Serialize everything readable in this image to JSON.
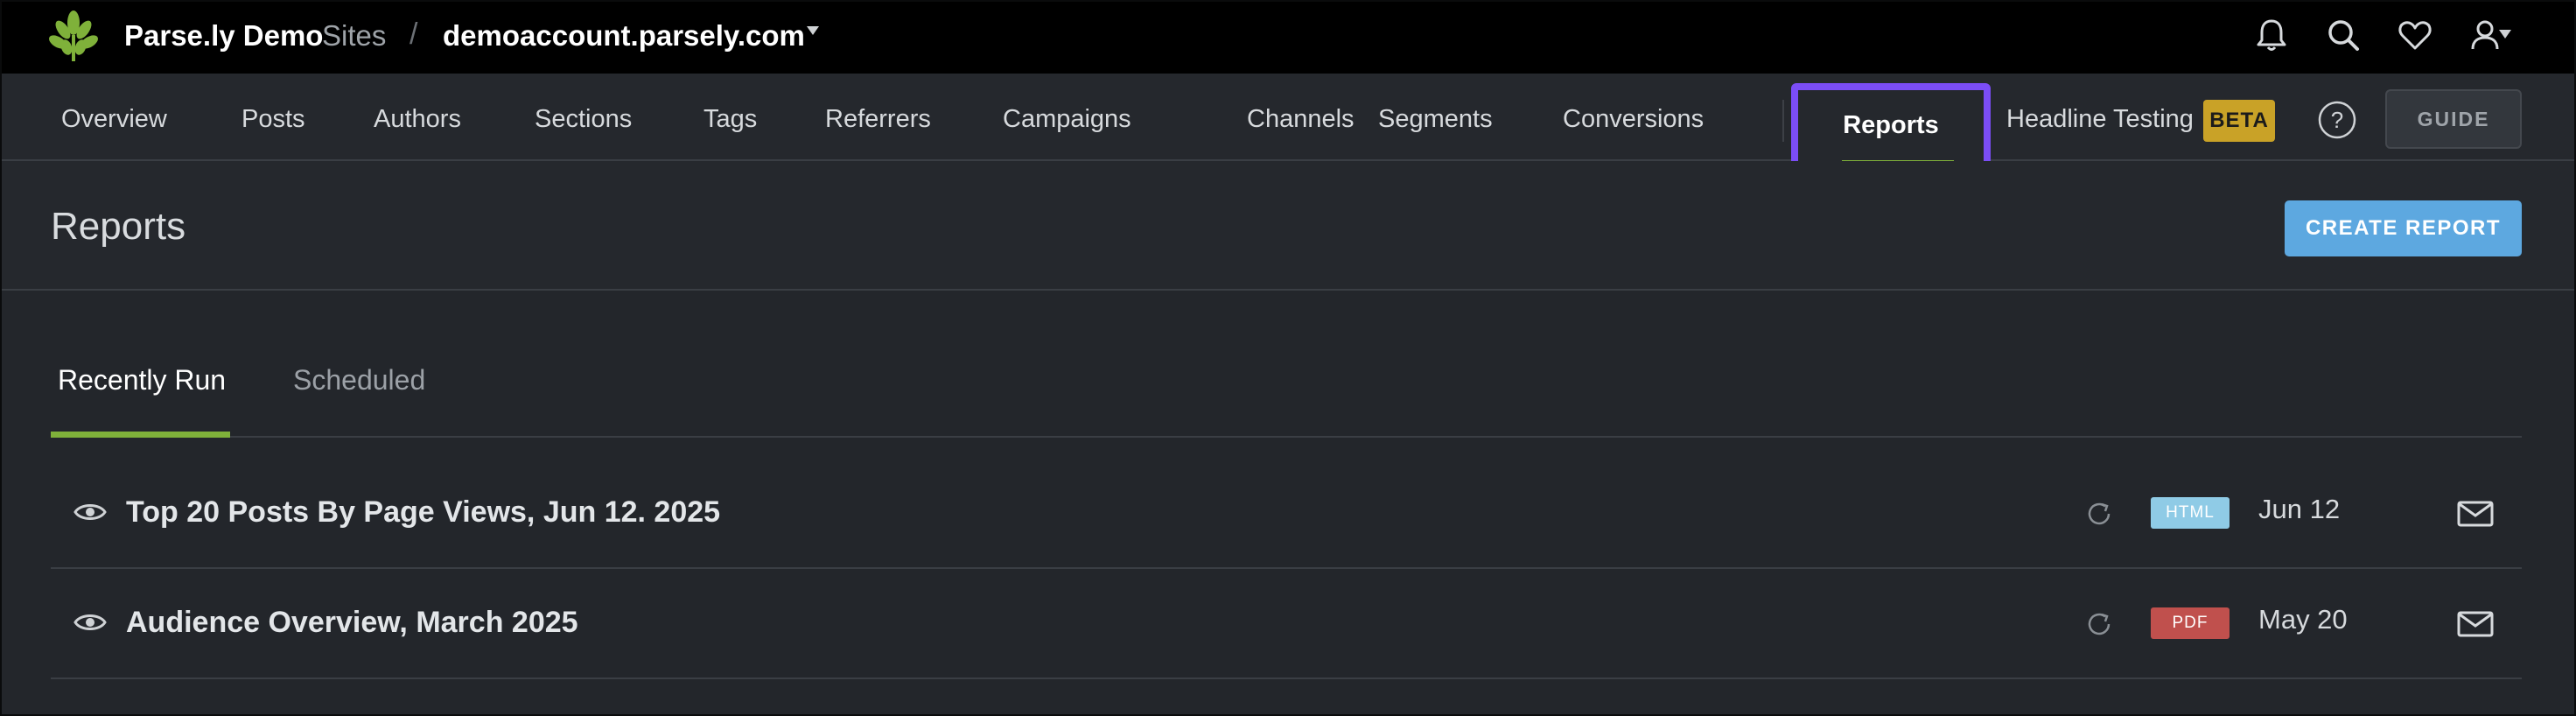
{
  "topbar": {
    "brand": "Parse.ly Demo",
    "sites_label": "Sites",
    "separator": "/",
    "account": "demoaccount.parsely.com",
    "icons": [
      "bell-icon",
      "search-icon",
      "heart-icon",
      "user-icon"
    ]
  },
  "nav": {
    "items": [
      {
        "label": "Overview"
      },
      {
        "label": "Posts"
      },
      {
        "label": "Authors"
      },
      {
        "label": "Sections"
      },
      {
        "label": "Tags"
      },
      {
        "label": "Referrers"
      },
      {
        "label": "Campaigns"
      },
      {
        "label": "Channels"
      },
      {
        "label": "Segments"
      },
      {
        "label": "Conversions"
      }
    ],
    "reports": "Reports",
    "headline_testing": "Headline Testing",
    "beta_badge": "BETA",
    "help": "?",
    "guide": "GUIDE"
  },
  "page": {
    "title": "Reports",
    "create_button": "CREATE REPORT"
  },
  "tabs": {
    "recently_run": "Recently Run",
    "scheduled": "Scheduled"
  },
  "reports": [
    {
      "name": "Top 20 Posts By Page Views, Jun 12. 2025",
      "format": "HTML",
      "format_color": "#8fcbe6",
      "date": "Jun 12"
    },
    {
      "name": "Audience Overview, March 2025",
      "format": "PDF",
      "format_color": "#c0504d",
      "date": "May 20"
    }
  ],
  "colors": {
    "accent_green": "#7fb13a",
    "highlight_purple": "#7b4df6",
    "button_blue": "#5da8e0",
    "beta_gold": "#c9a227"
  }
}
